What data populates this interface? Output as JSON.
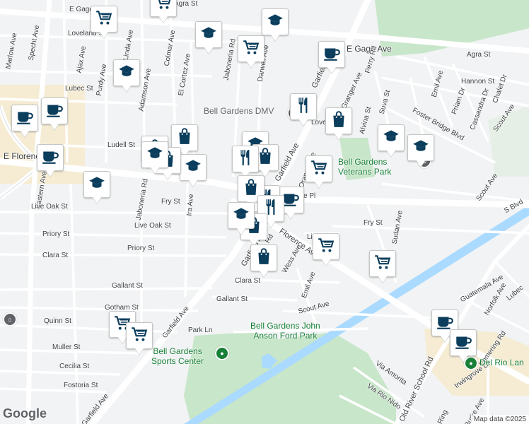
{
  "map": {
    "attribution": "Map data ©2025",
    "logo": "Google",
    "colors": {
      "background": "#f1f3f4",
      "park": "#c8e6c9",
      "road": "#ffffff",
      "commercial": "#f5ecd3",
      "water": "#aadaff",
      "marker_icon": "#0b3d5c"
    }
  },
  "streets": [
    {
      "name": "E Gage",
      "id": "e-gage-west"
    },
    {
      "name": "Agra St",
      "id": "agra-st-north"
    },
    {
      "name": "Loveland St",
      "id": "loveland-st"
    },
    {
      "name": "Specht Ave",
      "id": "specht-ave"
    },
    {
      "name": "Marlow Ave",
      "id": "marlow-ave"
    },
    {
      "name": "Ajax Ave",
      "id": "ajax-ave"
    },
    {
      "name": "Purdy Ave",
      "id": "purdy-ave"
    },
    {
      "name": "Lubec St",
      "id": "lubec-st"
    },
    {
      "name": "Adamson Ave",
      "id": "adamson-ave"
    },
    {
      "name": "Colmar Ave",
      "id": "colmar-ave"
    },
    {
      "name": "El Cortez Ave",
      "id": "el-cortez-ave"
    },
    {
      "name": "Jaboneria Rd",
      "id": "jaboneria-rd-north"
    },
    {
      "name": "Darwell Ave",
      "id": "darwell-ave"
    },
    {
      "name": "Ludell St",
      "id": "ludell-st"
    },
    {
      "name": "E Florence",
      "id": "e-florence"
    },
    {
      "name": "Eastern Ave",
      "id": "eastern-ave"
    },
    {
      "name": "Live Oak St",
      "id": "live-oak-st-west"
    },
    {
      "name": "Jaboneria Rd",
      "id": "jaboneria-rd-south"
    },
    {
      "name": "Fry St",
      "id": "fry-st-west"
    },
    {
      "name": "Live Oak St",
      "id": "live-oak-st-mid"
    },
    {
      "name": "Priory St",
      "id": "priory-st"
    },
    {
      "name": "Priory St",
      "id": "priory-st-west"
    },
    {
      "name": "Clara St",
      "id": "clara-st-west"
    },
    {
      "name": "Gallant St",
      "id": "gallant-st-west"
    },
    {
      "name": "Gotham St",
      "id": "gotham-st"
    },
    {
      "name": "Quinn St",
      "id": "quinn-st"
    },
    {
      "name": "Muller St",
      "id": "muller-st"
    },
    {
      "name": "Cecilia St",
      "id": "cecilia-st"
    },
    {
      "name": "Fostoria St",
      "id": "fostoria-st"
    },
    {
      "name": "Garfield Ave",
      "id": "garfield-ave-sw"
    },
    {
      "name": "Garfield Ave",
      "id": "garfield-ave-sw2"
    },
    {
      "name": "Park Ln",
      "id": "park-ln"
    },
    {
      "name": "Gallant St",
      "id": "gallant-st"
    },
    {
      "name": "Clara St",
      "id": "clara-st"
    },
    {
      "name": "Scout Ave",
      "id": "scout-ave-south"
    },
    {
      "name": "Emil Ave",
      "id": "emil-ave"
    },
    {
      "name": "Florence Ave",
      "id": "florence-ave"
    },
    {
      "name": "Garfield Ave",
      "id": "garfield-ave-ne"
    },
    {
      "name": "Garfield",
      "id": "garfield-north"
    },
    {
      "name": "Granger Ave",
      "id": "granger-ave"
    },
    {
      "name": "E Gage Ave",
      "id": "e-gage-ave-east"
    },
    {
      "name": "Agra St",
      "id": "agra-st-east"
    },
    {
      "name": "Perry Rd",
      "id": "perry-rd"
    },
    {
      "name": "Emil Ave",
      "id": "emil-ave-north"
    },
    {
      "name": "Hannon St",
      "id": "hannon-st"
    },
    {
      "name": "Priam Dr",
      "id": "priam-dr"
    },
    {
      "name": "Cassandra Dr",
      "id": "cassandra-dr"
    },
    {
      "name": "Chalet Dr",
      "id": "chalet-dr"
    },
    {
      "name": "Suva St",
      "id": "suva-st"
    },
    {
      "name": "Alvina St",
      "id": "alvina-st"
    },
    {
      "name": "Foster Bridge Blvd",
      "id": "foster-bridge-blvd"
    },
    {
      "name": "Scout Ave",
      "id": "scout-ave-ne"
    },
    {
      "name": "Scout Ave",
      "id": "scout-ave-east"
    },
    {
      "name": "Sudan Ave",
      "id": "sudan-ave"
    },
    {
      "name": "Fry St",
      "id": "fry-st-east"
    },
    {
      "name": "Lind St",
      "id": "lind-st"
    },
    {
      "name": "Guatemala Ave",
      "id": "guatemala-ave"
    },
    {
      "name": "Norfolk Ave",
      "id": "norfolk-ave"
    },
    {
      "name": "Lubec",
      "id": "lubec-east"
    },
    {
      "name": "Pomering Rd",
      "id": "pomering-rd"
    },
    {
      "name": "Old River School Rd",
      "id": "old-river-school-rd"
    },
    {
      "name": "Irwingrove Dr",
      "id": "irwingrove-dr"
    },
    {
      "name": "Via Amorita",
      "id": "via-amorita"
    },
    {
      "name": "Via Rio Nido",
      "id": "via-rio-nido"
    },
    {
      "name": "S Blvd",
      "id": "s-blvd"
    },
    {
      "name": "Wess Ave",
      "id": "wess-ave"
    },
    {
      "name": "Ira Ave",
      "id": "ira-ave"
    },
    {
      "name": "Linda Ave",
      "id": "linda-ave"
    },
    {
      "name": "Garfield Ave",
      "id": "garfield-ave-lower"
    },
    {
      "name": "Lovelace",
      "id": "lovelace-st"
    },
    {
      "name": "Orange Ave",
      "id": "orange-ave"
    },
    {
      "name": "ce Pl",
      "id": "ce-pl"
    },
    {
      "name": "Rd",
      "id": "rd-center"
    },
    {
      "name": "Burke Ave",
      "id": "burke-ave"
    },
    {
      "name": "Ring",
      "id": "ring-rd"
    }
  ],
  "places": [
    {
      "name": "Bell Gardens DMV",
      "id": "bell-gardens-dmv"
    },
    {
      "name": "Bell Gardens\nVeterans Park",
      "id": "veterans-park"
    },
    {
      "name": "Bell Gardens John\nAnson Ford Park",
      "id": "john-anson-ford-park"
    },
    {
      "name": "Bell Gardens\nSports Center",
      "id": "sports-center"
    },
    {
      "name": "Del Rio Lan",
      "id": "del-rio-lan"
    }
  ],
  "markers": [
    {
      "icon": "shopping-cart",
      "id": "m1"
    },
    {
      "icon": "shopping-cart",
      "id": "m2"
    },
    {
      "icon": "graduation-cap",
      "id": "m3"
    },
    {
      "icon": "graduation-cap",
      "id": "m4"
    },
    {
      "icon": "shopping-cart",
      "id": "m5"
    },
    {
      "icon": "coffee-cup",
      "id": "m6"
    },
    {
      "icon": "graduation-cap",
      "id": "m7"
    },
    {
      "icon": "coffee-cup",
      "id": "m8"
    },
    {
      "icon": "coffee-cup",
      "id": "m9"
    },
    {
      "icon": "coffee-cup",
      "id": "m10"
    },
    {
      "icon": "graduation-cap",
      "id": "m11"
    },
    {
      "icon": "shopping-bag",
      "id": "m12"
    },
    {
      "icon": "shopping-bag",
      "id": "m13"
    },
    {
      "icon": "graduation-cap",
      "id": "m14"
    },
    {
      "icon": "shopping-bag",
      "id": "m15"
    },
    {
      "icon": "graduation-cap",
      "id": "m16"
    },
    {
      "icon": "fork-knife",
      "id": "m17"
    },
    {
      "icon": "shopping-bag",
      "id": "m18"
    },
    {
      "icon": "graduation-cap",
      "id": "m19"
    },
    {
      "icon": "shopping-bag",
      "id": "m20"
    },
    {
      "icon": "fork-knife",
      "id": "m21"
    },
    {
      "icon": "coffee-cup",
      "id": "m22"
    },
    {
      "icon": "fork-knife",
      "id": "m23"
    },
    {
      "icon": "graduation-cap",
      "id": "m24"
    },
    {
      "icon": "shopping-bag",
      "id": "m25"
    },
    {
      "icon": "fork-knife",
      "id": "m26"
    },
    {
      "icon": "shopping-bag",
      "id": "m27"
    },
    {
      "icon": "shopping-bag",
      "id": "m28"
    },
    {
      "icon": "shopping-cart",
      "id": "m29"
    },
    {
      "icon": "graduation-cap",
      "id": "m30"
    },
    {
      "icon": "graduation-cap",
      "id": "m31"
    },
    {
      "icon": "shopping-cart",
      "id": "m32"
    },
    {
      "icon": "shopping-cart",
      "id": "m33"
    },
    {
      "icon": "shopping-cart",
      "id": "m34"
    },
    {
      "icon": "shopping-cart",
      "id": "m35"
    },
    {
      "icon": "coffee-cup",
      "id": "m36"
    },
    {
      "icon": "coffee-cup",
      "id": "m37"
    }
  ]
}
